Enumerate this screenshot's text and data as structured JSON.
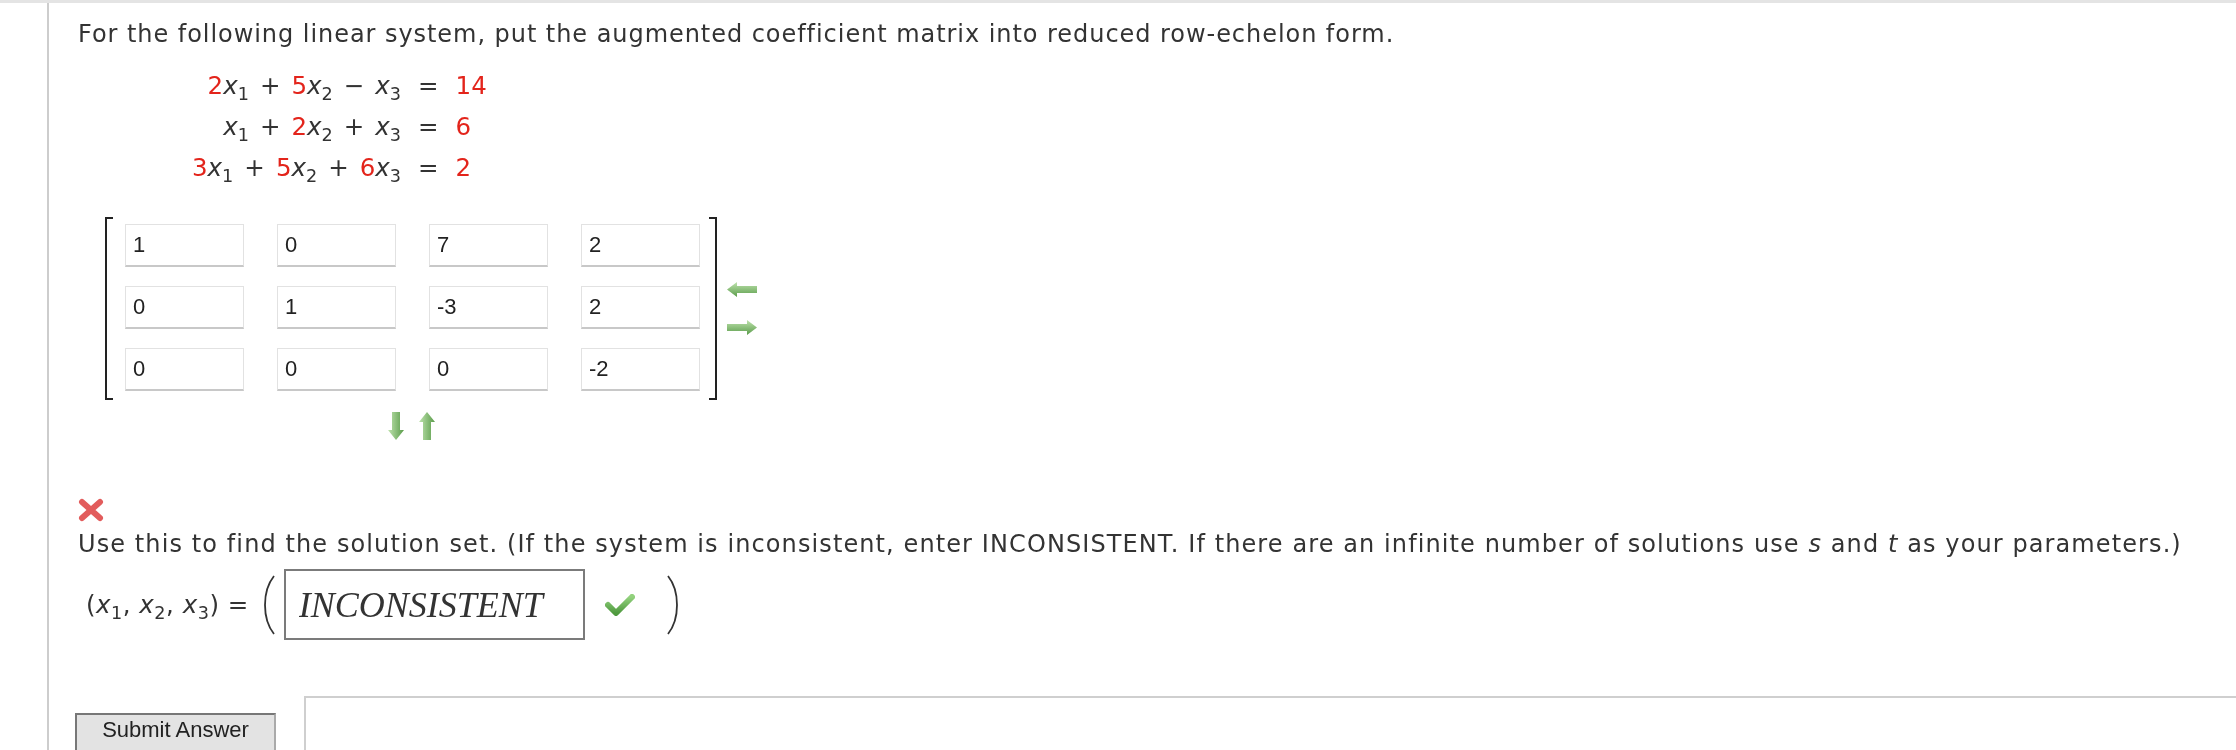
{
  "instruction": "For the following linear system, put the augmented coefficient matrix into reduced row-echelon form.",
  "system": {
    "equations": [
      {
        "terms": [
          {
            "coefficient": "2",
            "variable": "x",
            "index": "1"
          },
          {
            "operator": "+",
            "coefficient": "5",
            "variable": "x",
            "index": "2"
          },
          {
            "operator": "−",
            "variable": "x",
            "index": "3"
          }
        ],
        "relation": "=",
        "rhs": "14"
      },
      {
        "terms": [
          {
            "variable": "x",
            "index": "1"
          },
          {
            "operator": "+",
            "coefficient": "2",
            "variable": "x",
            "index": "2"
          },
          {
            "operator": "+",
            "variable": "x",
            "index": "3"
          }
        ],
        "relation": "=",
        "rhs": "6"
      },
      {
        "terms": [
          {
            "coefficient": "3",
            "variable": "x",
            "index": "1"
          },
          {
            "operator": "+",
            "coefficient": "5",
            "variable": "x",
            "index": "2"
          },
          {
            "operator": "+",
            "coefficient": "6",
            "variable": "x",
            "index": "3"
          }
        ],
        "relation": "=",
        "rhs": "2"
      }
    ]
  },
  "matrix": {
    "rows": [
      [
        "1",
        "0",
        "7",
        "2"
      ],
      [
        "0",
        "1",
        "-3",
        "2"
      ],
      [
        "0",
        "0",
        "0",
        "-2"
      ]
    ],
    "correct": false
  },
  "solution": {
    "prompt": "Use this to find the solution set. (If the system is inconsistent, enter INCONSISTENT. If there are an infinite number of solutions use *s* and *t* as your parameters.)",
    "label": "(*x*$_{1}$, *x*$_{2}$, *x*$_{3}$) =",
    "answer": "INCONSISTENT",
    "correct": true
  },
  "submit_button": "Submit Answer"
}
